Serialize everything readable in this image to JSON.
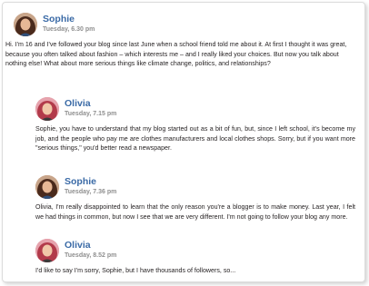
{
  "comments": [
    {
      "author": "Sophie",
      "time": "Tuesday, 6.30 pm",
      "avatar": "sophie-avatar",
      "text": "Hi. I'm 16 and I've followed your blog since last June when a school friend told me about it. At first I thought it was great, because you often talked about fashion – which interests me – and I really liked your choices. But now you talk about nothing else! What about more serious things like climate change, politics, and relationships?"
    },
    {
      "author": "Olivia",
      "time": "Tuesday, 7.15 pm",
      "avatar": "olivia-avatar",
      "text": "Sophie, you have to understand that my blog started out as a bit of fun, but, since I left school, it's become my job, and the people who pay me are clothes manufacturers and local clothes shops. Sorry, but if you want more \"serious things,\" you'd better read a newspaper."
    },
    {
      "author": "Sophie",
      "time": "Tuesday, 7.36 pm",
      "avatar": "sophie-avatar",
      "text": "Olivia, I'm really disappointed to learn that the only reason you're a blogger is to make money. Last year, I felt we had things in common, but now I see that we are very different. I'm not going to follow your blog any more."
    },
    {
      "author": "Olivia",
      "time": "Tuesday, 8.52 pm",
      "avatar": "olivia-avatar",
      "text": "I'd like to say I'm sorry, Sophie, but I have thousands of followers, so..."
    }
  ],
  "colors": {
    "name": "#3a6aa6",
    "time": "#8f8f8f",
    "text": "#231f20"
  }
}
